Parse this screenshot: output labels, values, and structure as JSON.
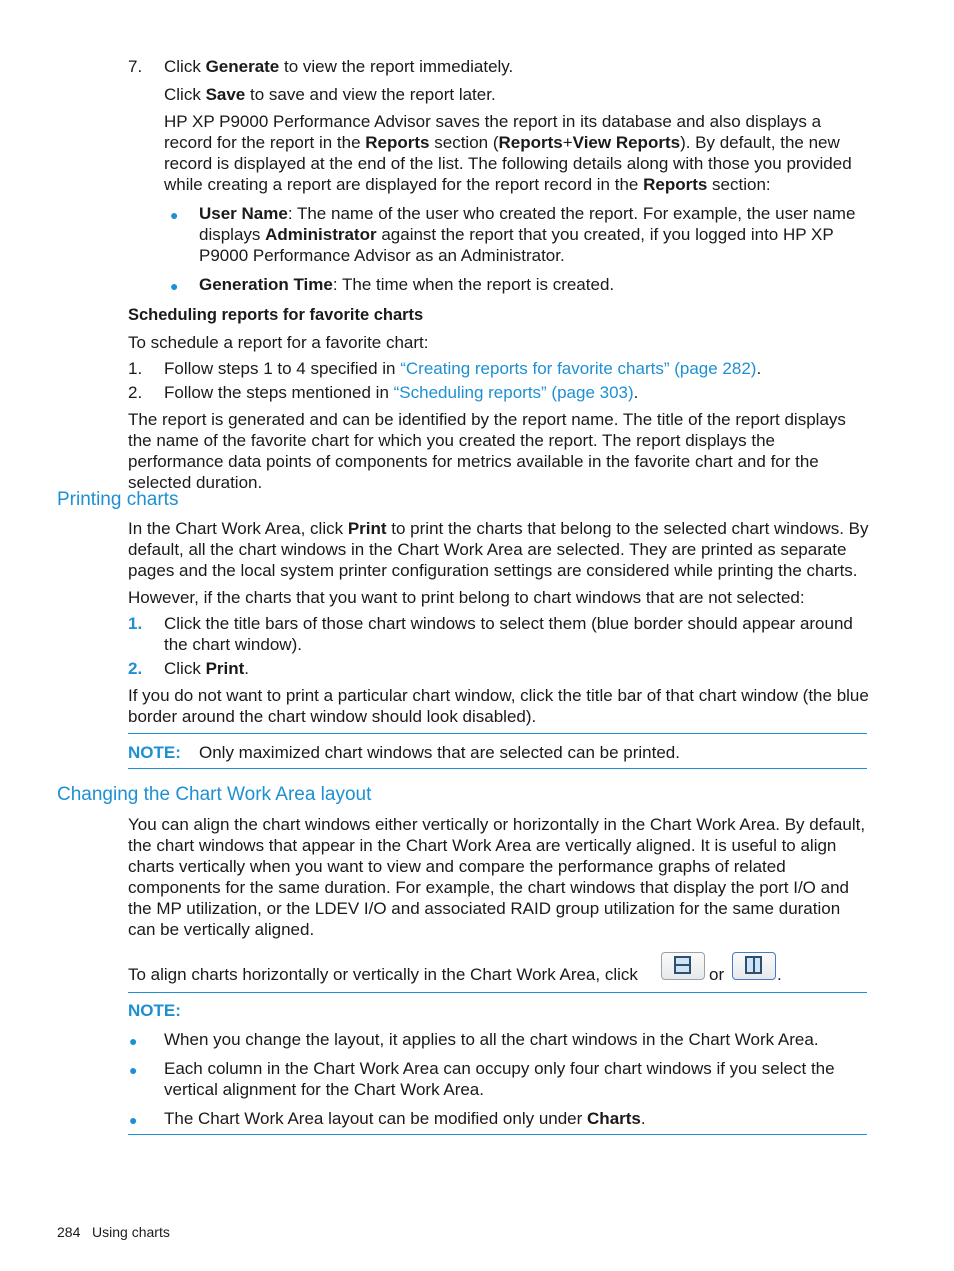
{
  "step7": {
    "number": "7.",
    "line1": {
      "pre": "Click ",
      "bold": "Generate",
      "post": " to view the report immediately."
    },
    "line2": {
      "pre": "Click ",
      "bold": "Save",
      "post": " to save and view the report later."
    },
    "para": {
      "t1": "HP XP P9000 Performance Advisor saves the report in its database and also displays a record for the report in the ",
      "b1": "Reports",
      "t2": " section (",
      "b2": "Reports",
      "t3": "+",
      "b3": "View Reports",
      "t4": "). By default, the new record is displayed at the end of the list. The following details along with those you provided while creating a report are displayed for the report record in the ",
      "b4": "Reports",
      "t5": " section:"
    },
    "bullets": [
      {
        "bold": "User Name",
        "t1": ": The name of the user who created the report. For example, the user name displays ",
        "bold2": "Administrator",
        "t2": " against the report that you created, if you logged into HP XP P9000 Performance Advisor as an Administrator."
      },
      {
        "bold": "Generation Time",
        "t1": ": The time when the report is created."
      }
    ]
  },
  "scheduling": {
    "heading": "Scheduling reports for favorite charts",
    "intro": "To schedule a report for a favorite chart:",
    "steps": [
      {
        "num": "1.",
        "pre": "Follow steps 1 to 4 specified in ",
        "link": "“Creating reports for favorite charts” (page 282)",
        "post": "."
      },
      {
        "num": "2.",
        "pre": "Follow the steps mentioned in ",
        "link": "“Scheduling reports” (page 303)",
        "post": "."
      }
    ],
    "closing": "The report is generated and can be identified by the report name. The title of the report displays the name of the favorite chart for which you created the report. The report displays the performance data points of components for metrics available in the favorite chart and for the selected duration."
  },
  "printing": {
    "heading": "Printing charts",
    "p1": {
      "pre": "In the Chart Work Area, click ",
      "bold": "Print",
      "post": " to print the charts that belong to the selected chart windows. By default, all the chart windows in the Chart Work Area are selected. They are printed as separate pages and the local system printer configuration settings are considered while printing the charts."
    },
    "p2": "However, if the charts that you want to print belong to chart windows that are not selected:",
    "steps": [
      {
        "num": "1.",
        "text": "Click the title bars of those chart windows to select them (blue border should appear around the chart window)."
      },
      {
        "num": "2.",
        "pre": "Click ",
        "bold": "Print",
        "post": "."
      }
    ],
    "p3": "If you do not want to print a particular chart window, click the title bar of that chart window (the blue border around the chart window should look disabled).",
    "note": {
      "label": "NOTE:",
      "text": "Only maximized chart windows that are selected can be printed."
    }
  },
  "layout": {
    "heading": "Changing the Chart Work Area layout",
    "p1": "You can align the chart windows either vertically or horizontally in the Chart Work Area. By default, the chart windows that appear in the Chart Work Area are vertically aligned. It is useful to align charts vertically when you want to view and compare the performance graphs of related components for the same duration. For example, the chart windows that display the port I/O and the MP utilization, or the LDEV I/O and associated RAID group utilization for the same duration can be vertically aligned.",
    "p2": {
      "pre": "To align charts horizontally or vertically in the Chart Work Area, click ",
      "mid": " or ",
      "post": ".",
      "icon1": "horizontal-layout-icon",
      "icon2": "vertical-layout-icon"
    },
    "note": {
      "label": "NOTE:",
      "bullets": [
        {
          "text": "When you change the layout, it applies to all the chart windows in the Chart Work Area."
        },
        {
          "text": "Each column in the Chart Work Area can occupy only four chart windows if you select the vertical alignment for the Chart Work Area."
        },
        {
          "pre": "The Chart Work Area layout can be modified only under ",
          "bold": "Charts",
          "post": "."
        }
      ]
    }
  },
  "footer": {
    "page": "284",
    "section": "Using charts"
  },
  "colors": {
    "accent": "#1e90d2",
    "text": "#1a1a1a"
  }
}
